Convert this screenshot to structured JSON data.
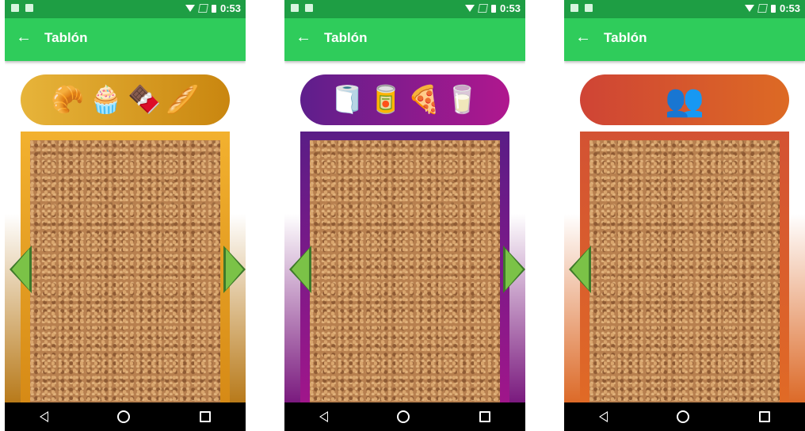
{
  "status_bar": {
    "time": "0:53"
  },
  "app_bar": {
    "title": "Tablón",
    "back_icon": "←"
  },
  "screens": [
    {
      "category_icons": [
        "🥐",
        "🧁",
        "🍫",
        "🥖"
      ],
      "accent": "#e3a92b"
    },
    {
      "category_icons": [
        "🧻",
        "🥫",
        "🍕",
        "🥛"
      ],
      "accent": "#6b1d8e"
    },
    {
      "category_icons": [
        "👥"
      ],
      "accent": "#d5553a"
    }
  ],
  "nav_bar": {
    "back": "back-icon",
    "home": "home-icon",
    "recents": "recents-icon"
  }
}
